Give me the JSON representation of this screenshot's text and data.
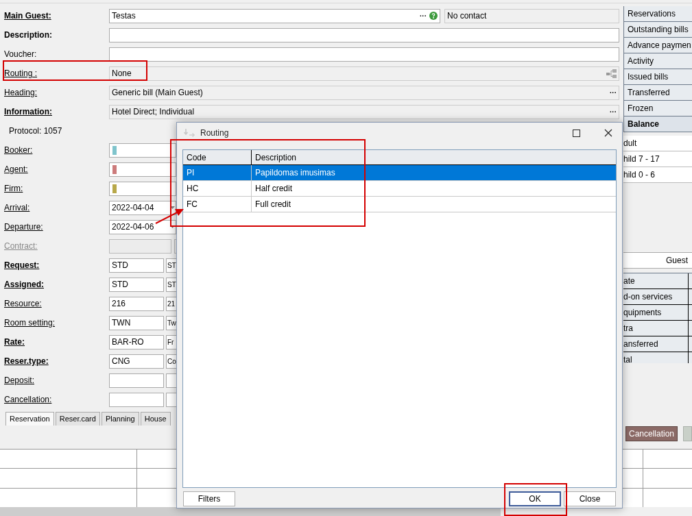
{
  "form": {
    "rows": [
      {
        "kind": "guest",
        "label": "Main Guest:",
        "bold": true,
        "link": true,
        "disabled": false,
        "value": "Testas",
        "more": "···",
        "contact": "No contact"
      },
      {
        "kind": "wide",
        "label": "Description:",
        "bold": true,
        "link": false,
        "disabled": false
      },
      {
        "kind": "wide",
        "label": "Voucher:",
        "bold": false,
        "link": false,
        "disabled": false
      },
      {
        "kind": "routing",
        "label": "Routing :",
        "bold": false,
        "link": true,
        "disabled": false,
        "value": "None"
      },
      {
        "kind": "readonly",
        "label": "Heading:",
        "bold": false,
        "link": true,
        "disabled": false,
        "value": "Generic bill (Main Guest)",
        "more": "···"
      },
      {
        "kind": "readonly",
        "label": "Information:",
        "bold": true,
        "link": true,
        "disabled": false,
        "value": "Hotel Direct; Individual",
        "more": "···"
      },
      {
        "kind": "note",
        "text": "Protocol: 1057",
        "bold": false,
        "link": false,
        "disabled": false
      },
      {
        "kind": "color",
        "label": "Booker:",
        "bold": false,
        "link": true,
        "disabled": false,
        "color": "#7fc4cc"
      },
      {
        "kind": "color",
        "label": "Agent:",
        "bold": false,
        "link": true,
        "disabled": false,
        "color": "#cc7b7b"
      },
      {
        "kind": "color",
        "label": "Firm:",
        "bold": false,
        "link": true,
        "disabled": false,
        "color": "#b8a84a"
      },
      {
        "kind": "date",
        "label": "Arrival:",
        "bold": false,
        "link": true,
        "disabled": false,
        "value": "2022-04-04"
      },
      {
        "kind": "date",
        "label": "Departure:",
        "bold": false,
        "link": true,
        "disabled": false,
        "value": "2022-04-06"
      },
      {
        "kind": "pair",
        "label": "Contract:",
        "bold": false,
        "link": true,
        "disabled": true
      },
      {
        "kind": "pair",
        "label": "Request:",
        "bold": true,
        "link": true,
        "disabled": false,
        "code": "STD",
        "name": "ST"
      },
      {
        "kind": "pair",
        "label": "Assigned:",
        "bold": true,
        "link": true,
        "disabled": false,
        "code": "STD",
        "name": "ST"
      },
      {
        "kind": "pair",
        "label": "Resource:",
        "bold": false,
        "link": true,
        "disabled": false,
        "code": "216",
        "name": "21"
      },
      {
        "kind": "pair",
        "label": "Room setting:",
        "bold": false,
        "link": true,
        "disabled": false,
        "code": "TWN",
        "name": "Tw"
      },
      {
        "kind": "pair",
        "label": "Rate:",
        "bold": true,
        "link": true,
        "disabled": false,
        "code": "BAR-RO",
        "name": "Fr"
      },
      {
        "kind": "pair",
        "label": "Reser.type:",
        "bold": true,
        "link": true,
        "disabled": false,
        "code": "CNG",
        "name": "Co"
      },
      {
        "kind": "pair",
        "label": "Deposit:",
        "bold": false,
        "link": true,
        "disabled": false
      },
      {
        "kind": "pair",
        "label": "Cancellation:",
        "bold": false,
        "link": true,
        "disabled": false
      }
    ],
    "tabs": [
      {
        "label": "Reservation",
        "selected": true
      },
      {
        "label": "Reser.card",
        "selected": false
      },
      {
        "label": "Planning",
        "selected": false
      },
      {
        "label": "House",
        "selected": false
      }
    ]
  },
  "side_panel": {
    "tabs": [
      {
        "label": "Reservations",
        "selected": false
      },
      {
        "label": "Outstanding bills",
        "selected": false
      },
      {
        "label": "Advance paymen",
        "selected": false
      },
      {
        "label": "Activity",
        "selected": false
      },
      {
        "label": "Issued bills",
        "selected": false
      },
      {
        "label": "Transferred",
        "selected": false
      },
      {
        "label": "Frozen",
        "selected": false
      },
      {
        "label": "Balance",
        "selected": true
      }
    ],
    "guests": [
      "dult",
      "hild 7 - 17",
      "hild 0 - 6"
    ],
    "totals": {
      "heading": "Guest",
      "rows": [
        "ate",
        "d-on services",
        "quipments",
        "tra",
        "ansferred",
        "tal"
      ]
    },
    "buttons": [
      {
        "label": "Cancellation",
        "kind": "danger"
      },
      {
        "kind": "plain"
      }
    ]
  },
  "dialog": {
    "title": "Routing",
    "columns": [
      "Code",
      "Description"
    ],
    "rows": [
      {
        "code": "PI",
        "description": "Papildomas imusimas",
        "selected": true
      },
      {
        "code": "HC",
        "description": "Half credit",
        "selected": false
      },
      {
        "code": "FC",
        "description": "Full credit",
        "selected": false
      }
    ],
    "buttons": [
      {
        "label": "Filters",
        "default": false
      },
      {
        "label": "OK",
        "default": true
      },
      {
        "label": "Close",
        "default": false
      }
    ]
  }
}
